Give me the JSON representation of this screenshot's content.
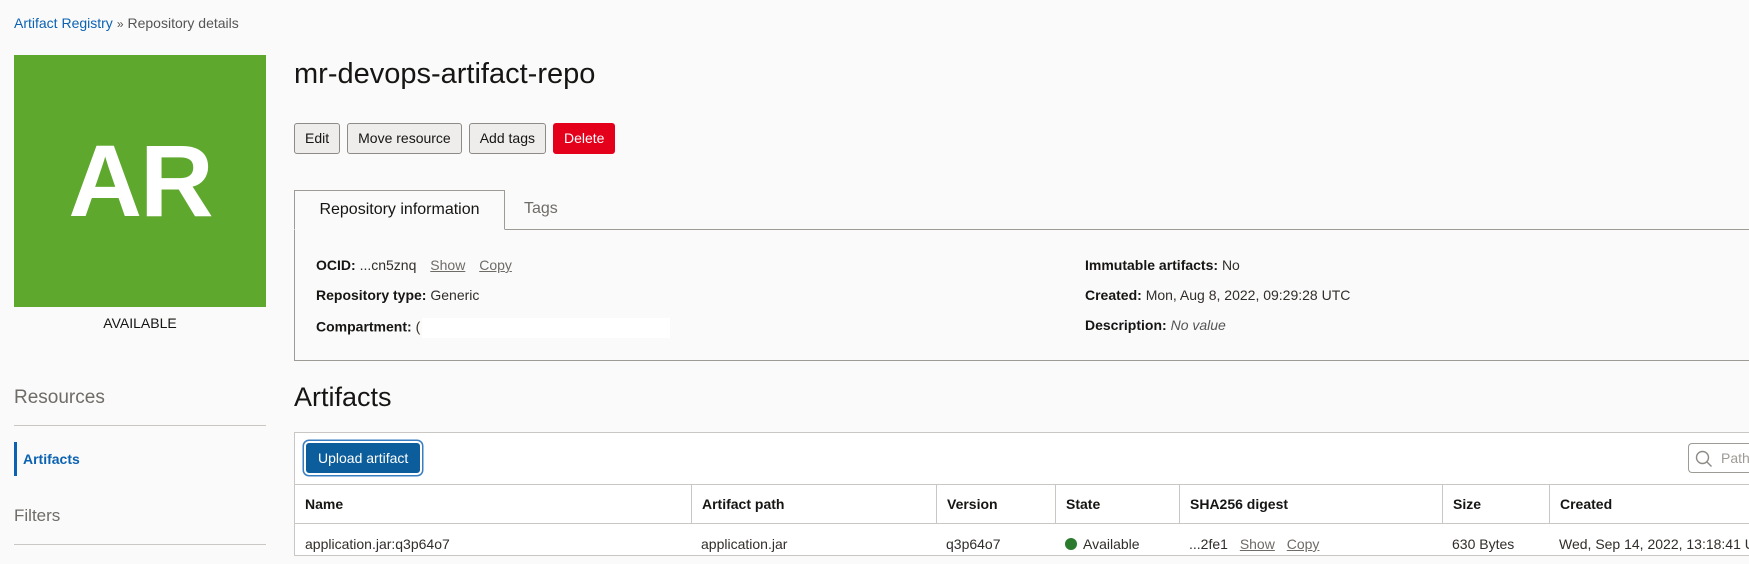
{
  "breadcrumb": {
    "root": "Artifact Registry",
    "current": "Repository details"
  },
  "tile": {
    "initials": "AR",
    "status": "AVAILABLE",
    "color": "#5fa82e"
  },
  "sidebar": {
    "resources_title": "Resources",
    "items": [
      {
        "label": "Artifacts"
      }
    ],
    "filters_title": "Filters"
  },
  "page_title": "mr-devops-artifact-repo",
  "actions": {
    "edit": "Edit",
    "move": "Move resource",
    "add_tags": "Add tags",
    "delete": "Delete"
  },
  "tabs": [
    {
      "label": "Repository information"
    },
    {
      "label": "Tags"
    }
  ],
  "info": {
    "ocid_label": "OCID:",
    "ocid_value": "...cn5znq",
    "show": "Show",
    "copy": "Copy",
    "repo_type_label": "Repository type:",
    "repo_type_value": "Generic",
    "compartment_label": "Compartment:",
    "compartment_value": "(",
    "immutable_label": "Immutable artifacts:",
    "immutable_value": "No",
    "created_label": "Created:",
    "created_value": "Mon, Aug 8, 2022, 09:29:28 UTC",
    "description_label": "Description:",
    "description_value": "No value"
  },
  "artifacts": {
    "title": "Artifacts",
    "upload_label": "Upload artifact",
    "search_placeholder": "Path",
    "columns": [
      "Name",
      "Artifact path",
      "Version",
      "State",
      "SHA256 digest",
      "Size",
      "Created"
    ],
    "rows": [
      {
        "name": "application.jar:q3p64o7",
        "path": "application.jar",
        "version": "q3p64o7",
        "state": "Available",
        "digest": "...2fe1",
        "show": "Show",
        "copy": "Copy",
        "size": "630 Bytes",
        "created": "Wed, Sep 14, 2022, 13:18:41 U"
      }
    ]
  },
  "colors": {
    "link": "#0b62b3",
    "primary": "#0b5d9b",
    "danger": "#e4001b",
    "available": "#2b7b2f"
  }
}
